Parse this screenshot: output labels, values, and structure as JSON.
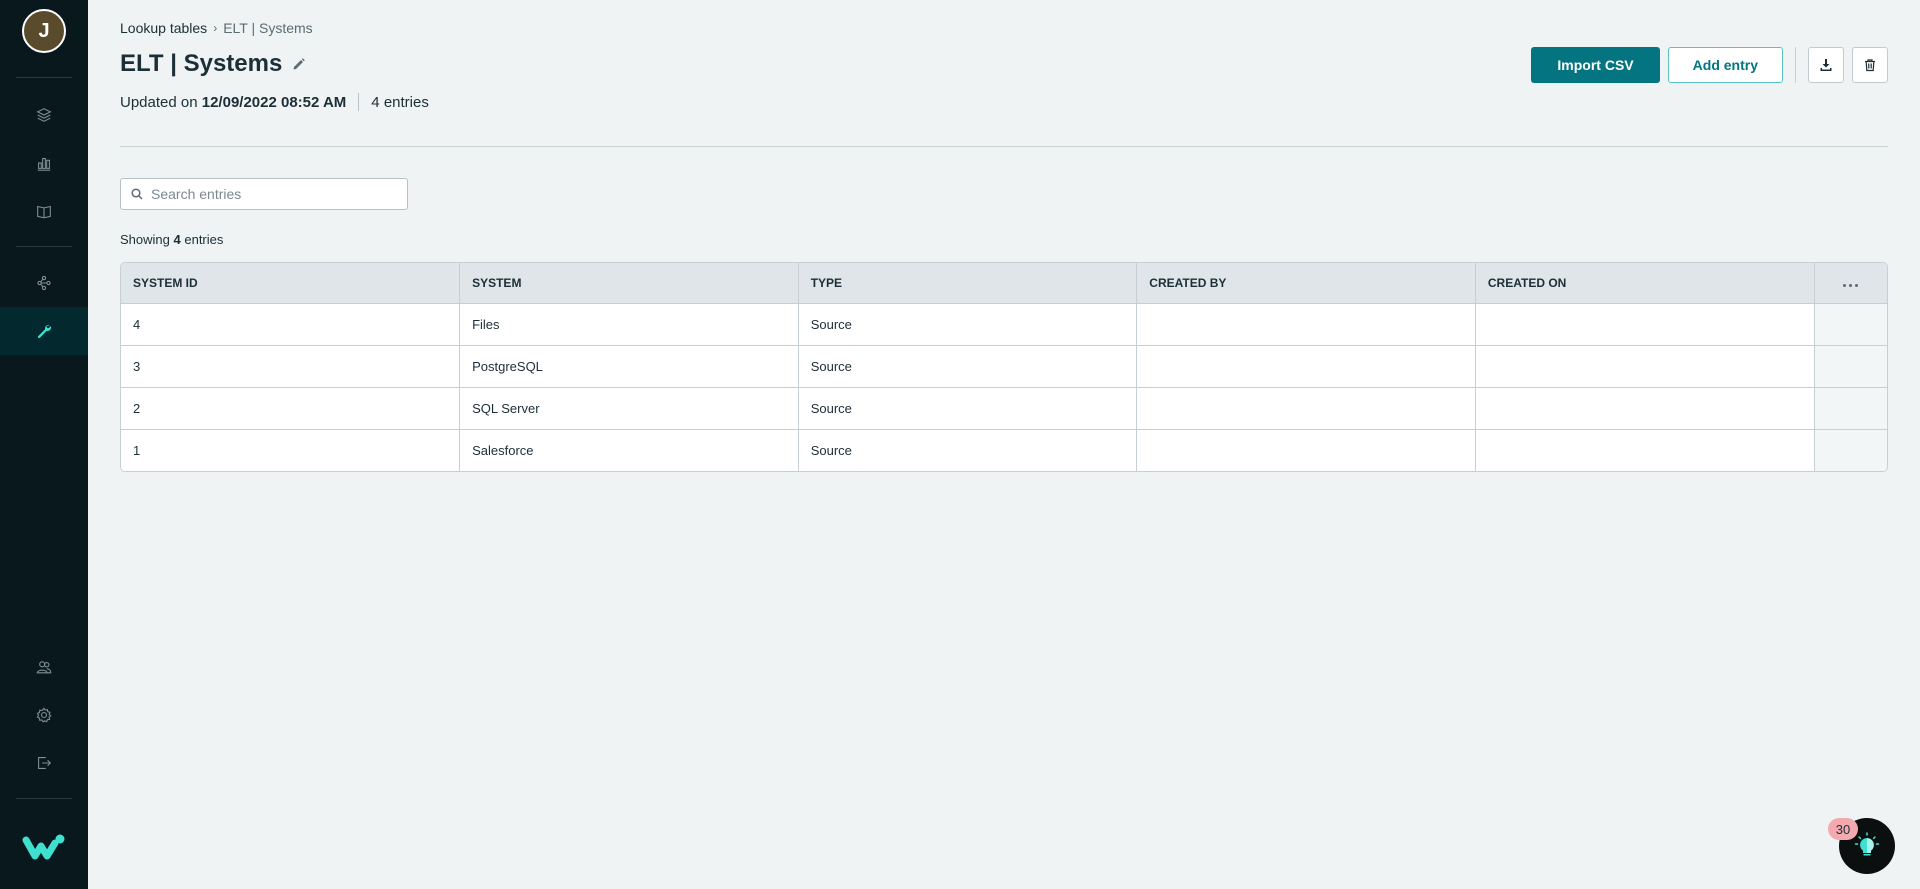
{
  "sidebar": {
    "avatar_initial": "J",
    "items": [
      {
        "name": "layers",
        "icon": "layers-icon"
      },
      {
        "name": "analytics",
        "icon": "bar-chart-icon"
      },
      {
        "name": "docs",
        "icon": "book-icon"
      },
      {
        "name": "connections",
        "icon": "share-nodes-icon"
      },
      {
        "name": "tools",
        "icon": "wrench-icon",
        "active": true
      },
      {
        "name": "users",
        "icon": "users-icon"
      },
      {
        "name": "settings",
        "icon": "gear-icon"
      },
      {
        "name": "logout",
        "icon": "logout-icon"
      }
    ]
  },
  "breadcrumb": {
    "parent": "Lookup tables",
    "current": "ELT | Systems"
  },
  "header": {
    "title": "ELT | Systems",
    "updated_label": "Updated on",
    "updated_value": "12/09/2022 08:52 AM",
    "entries_count": "4",
    "entries_label": "entries"
  },
  "toolbar": {
    "import_label": "Import CSV",
    "add_label": "Add entry"
  },
  "search": {
    "placeholder": "Search entries",
    "value": ""
  },
  "showing": {
    "prefix": "Showing",
    "count": "4",
    "suffix": "entries"
  },
  "table": {
    "columns": [
      "SYSTEM ID",
      "SYSTEM",
      "TYPE",
      "CREATED BY",
      "CREATED ON"
    ],
    "rows": [
      [
        "4",
        "Files",
        "Source",
        "",
        ""
      ],
      [
        "3",
        "PostgreSQL",
        "Source",
        "",
        ""
      ],
      [
        "2",
        "SQL Server",
        "Source",
        "",
        ""
      ],
      [
        "1",
        "Salesforce",
        "Source",
        "",
        ""
      ]
    ]
  },
  "help": {
    "badge_count": "30"
  },
  "colors": {
    "sidebar_bg": "#08181d",
    "accent": "#047580",
    "brand": "#3fe0d0",
    "badge": "#f2aaae"
  }
}
